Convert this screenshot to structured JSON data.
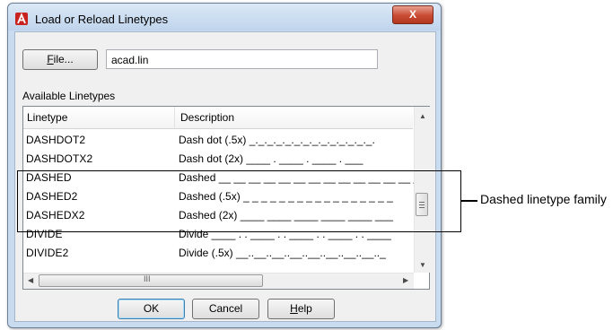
{
  "dialog": {
    "title": "Load or Reload Linetypes",
    "close_glyph": "X",
    "file_button": {
      "accel": "F",
      "rest": "ile..."
    },
    "file_value": "acad.lin",
    "available_label": "Available Linetypes",
    "columns": [
      "Linetype",
      "Description"
    ],
    "rows": [
      {
        "name": "DASHDOT2",
        "description": "Dash dot (.5x) _._._._._._._._._._._._._._."
      },
      {
        "name": "DASHDOTX2",
        "description": "Dash dot (2x) ____  .  ____  .  ____  .  ___"
      },
      {
        "name": "DASHED",
        "description": "Dashed __ __ __ __ __ __ __ __ __ __ __ __ __ _"
      },
      {
        "name": "DASHED2",
        "description": "Dashed (.5x) _ _ _ _ _ _ _ _ _ _ _ _ _ _ _ _ _"
      },
      {
        "name": "DASHEDX2",
        "description": "Dashed (2x) ____  ____  ____  ____  ____  ___"
      },
      {
        "name": "DIVIDE",
        "description": "Divide ____ . . ____ . . ____ . . ____ . . ____"
      },
      {
        "name": "DIVIDE2",
        "description": "Divide (.5x) __..__..__..__..__..__..__..__.._"
      }
    ],
    "hscroll_grip": "III",
    "ok_label": "OK",
    "cancel_label": "Cancel",
    "help_button": {
      "accel": "H",
      "rest": "elp"
    }
  },
  "annotation": {
    "label": "Dashed linetype family"
  },
  "colors": {
    "title_bg": "#c9dcef",
    "close_red": "#c94a33",
    "callout": "#000000"
  }
}
